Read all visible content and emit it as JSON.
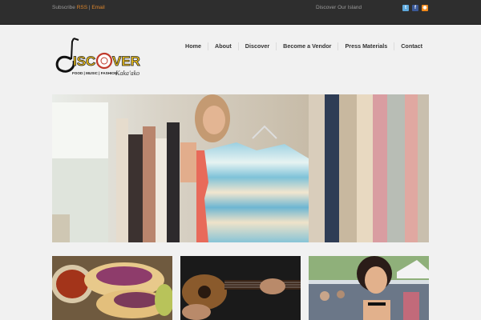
{
  "topbar": {
    "subscribe_label": "Subscribe",
    "rss_label": "RSS",
    "separator": "|",
    "email_label": "Email",
    "tagline": "Discover Our Island",
    "social": [
      "twitter-icon",
      "facebook-icon",
      "rss-icon"
    ]
  },
  "logo": {
    "wordmark": "DISCOVER",
    "subtitle": "FOOD | MUSIC | FASHION",
    "script": "Kaka'ako"
  },
  "nav": {
    "items": [
      "Home",
      "About",
      "Discover",
      "Become a Vendor",
      "Press Materials",
      "Contact"
    ]
  },
  "colors": {
    "topbar_bg": "#2e2e2e",
    "accent_orange": "#e0872c",
    "logo_yellow": "#f2c31a",
    "page_bg": "#f1f1f1"
  }
}
